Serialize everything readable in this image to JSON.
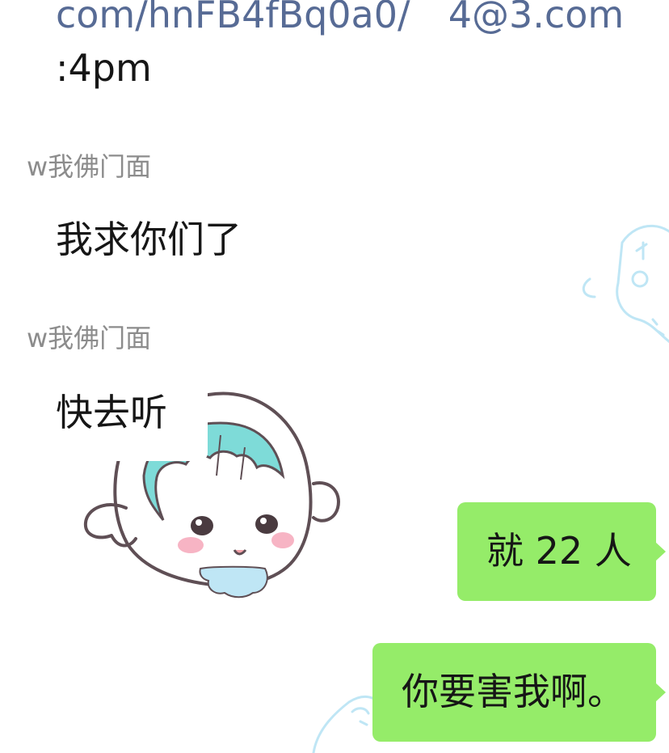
{
  "partial_message": {
    "link_text": "com/hnFB4fBq0a0/",
    "email_text": "4@3.com",
    "time_text": ":4pm"
  },
  "messages": [
    {
      "sender": "w我佛门面",
      "text": "我求你们了"
    },
    {
      "sender": "w我佛门面",
      "text": "快去听"
    }
  ],
  "outgoing": [
    {
      "text": "就 22 人"
    },
    {
      "text": "你要害我啊。"
    }
  ],
  "colors": {
    "outgoing_bubble": "#95ec69",
    "incoming_bubble": "#ffffff",
    "link": "#576b95",
    "sender_name": "#8c8c8c",
    "sticker_hair": "#7edbd8"
  },
  "sticker": {
    "name": "ghost-girl-sticker"
  }
}
